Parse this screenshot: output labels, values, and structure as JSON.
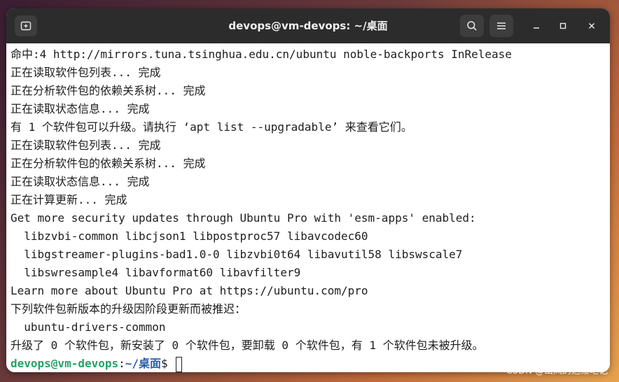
{
  "window": {
    "title": "devops@vm-devops: ~/桌面"
  },
  "titlebar_icons": {
    "new_tab": "new-tab-icon",
    "search": "search-icon",
    "menu": "hamburger-menu-icon",
    "minimize": "minimize-icon",
    "maximize": "maximize-icon",
    "close": "close-icon"
  },
  "terminal": {
    "lines": [
      "命中:4 http://mirrors.tuna.tsinghua.edu.cn/ubuntu noble-backports InRelease",
      "正在读取软件包列表... 完成",
      "正在分析软件包的依赖关系树... 完成",
      "正在读取状态信息... 完成",
      "有 1 个软件包可以升级。请执行 ‘apt list --upgradable’ 来查看它们。",
      "正在读取软件包列表... 完成",
      "正在分析软件包的依赖关系树... 完成",
      "正在读取状态信息... 完成",
      "正在计算更新... 完成",
      "Get more security updates through Ubuntu Pro with 'esm-apps' enabled:",
      "  libzvbi-common libcjson1 libpostproc57 libavcodec60",
      "  libgstreamer-plugins-bad1.0-0 libzvbi0t64 libavutil58 libswscale7",
      "  libswresample4 libavformat60 libavfilter9",
      "Learn more about Ubuntu Pro at https://ubuntu.com/pro",
      "下列软件包新版本的升级因阶段更新而被推迟：",
      "  ubuntu-drivers-common",
      "升级了 0 个软件包，新安装了 0 个软件包，要卸载 0 个软件包，有 1 个软件包未被升级。"
    ],
    "prompt": {
      "user_host": "devops@vm-devops",
      "separator": ":",
      "path": "~/桌面",
      "symbol": "$ "
    }
  },
  "watermark": "CSDN @山岚的运维笔记",
  "colors": {
    "titlebar": "#2c2c2c",
    "terminal_bg": "#ffffff",
    "prompt_user": "#26a269",
    "prompt_path": "#2a5ea8"
  }
}
